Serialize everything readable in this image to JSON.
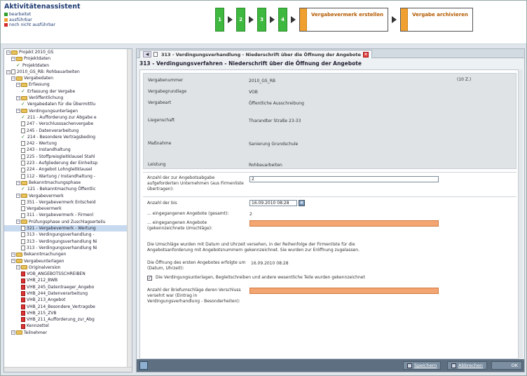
{
  "app": {
    "title": "Aktivitätenassistent",
    "legend": [
      {
        "label": "bearbeitet",
        "color": "#2e9e2e"
      },
      {
        "label": "ausführbar",
        "color": "#f0a030"
      },
      {
        "label": "noch nicht ausführbar",
        "color": "#d22b2b"
      }
    ]
  },
  "wizard": {
    "steps": [
      "1",
      "2",
      "3",
      "4"
    ],
    "boxes": [
      "Vergabevermerk erstellen",
      "Vergabe archivieren"
    ]
  },
  "tree": {
    "items": [
      {
        "label": "Projekt 2010_GS",
        "icon": "folder-icon",
        "indent": 0
      },
      {
        "label": "Projektdaten",
        "icon": "folder-icon",
        "indent": 1
      },
      {
        "label": "Projektdaten",
        "icon": "check-icon",
        "indent": 2
      },
      {
        "label": "2010_GS_RB: Rohbauarbeiten",
        "icon": "doc-icon",
        "indent": 0
      },
      {
        "label": "Vergabedaten",
        "icon": "folder-icon",
        "indent": 1
      },
      {
        "label": "Erfassung",
        "icon": "folder-icon",
        "indent": 2
      },
      {
        "label": "Erfassung der Vergabe",
        "icon": "check-icon",
        "indent": 3
      },
      {
        "label": "Veröffentlichung",
        "icon": "folder-icon",
        "indent": 2
      },
      {
        "label": "Vergabedaten für die Übermittlu",
        "icon": "check-icon",
        "indent": 3
      },
      {
        "label": "Verdingungsunterlagen",
        "icon": "folder-icon",
        "indent": 2
      },
      {
        "label": "211 - Aufforderung zur Abgabe e",
        "icon": "check-icon",
        "indent": 3
      },
      {
        "label": "247 - Verschlusssachenvergabe",
        "icon": "doc-icon",
        "indent": 3
      },
      {
        "label": "245 - Datenverarbeitung",
        "icon": "doc-icon",
        "indent": 3
      },
      {
        "label": "214 - Besondere Vertragsbeding",
        "icon": "check-icon",
        "indent": 3
      },
      {
        "label": "242 - Wertung",
        "icon": "doc-icon",
        "indent": 3
      },
      {
        "label": "243 - Instandhaltung",
        "icon": "doc-icon",
        "indent": 3
      },
      {
        "label": "225 - Stoffpreisgleitklausel Stahl",
        "icon": "doc-icon",
        "indent": 3
      },
      {
        "label": "223 - Aufgliederung der Einheitsp",
        "icon": "doc-icon",
        "indent": 3
      },
      {
        "label": "224 - Angebot Lohngleitklausel",
        "icon": "doc-icon",
        "indent": 3
      },
      {
        "label": "112 - Wartung / Instandhaltung -",
        "icon": "doc-icon",
        "indent": 3
      },
      {
        "label": "Bekanntmachungsphase",
        "icon": "folder-icon",
        "indent": 2
      },
      {
        "label": "121 - Bekanntmachung Öffentlic",
        "icon": "check-icon",
        "indent": 3
      },
      {
        "label": "Vergabevermerk",
        "icon": "folder-icon",
        "indent": 2
      },
      {
        "label": "351 - Vergabevermerk Entscheid",
        "icon": "doc-icon",
        "indent": 3
      },
      {
        "label": "Vergabevermerk",
        "icon": "doc-icon",
        "indent": 3
      },
      {
        "label": "311 - Vergabevermerk - Firmenl",
        "icon": "doc-icon",
        "indent": 3
      },
      {
        "label": "Prüfungsphase und Zuschlagserteilu",
        "icon": "folder-icon",
        "indent": 2
      },
      {
        "label": "321 - Vergabevermerk - Wertung",
        "icon": "doc-icon",
        "indent": 3,
        "selected": true
      },
      {
        "label": "313 - Verdingungsverhandlung -",
        "icon": "doc-icon",
        "indent": 3
      },
      {
        "label": "313 - Verdingungsverhandlung Ni",
        "icon": "doc-icon",
        "indent": 3
      },
      {
        "label": "313 - Verdingungsverhandlung Ni",
        "icon": "doc-icon",
        "indent": 3
      },
      {
        "label": "Bekanntmachungen",
        "icon": "folder-icon",
        "indent": 1
      },
      {
        "label": "Vergabeunterlagen",
        "icon": "folder-icon",
        "indent": 1
      },
      {
        "label": "Originalversion",
        "icon": "folder-icon",
        "indent": 2
      },
      {
        "label": "VOB_ANGEBOTSSCHREIBEN",
        "icon": "pdf-icon",
        "indent": 3
      },
      {
        "label": "VHB_212_BWB",
        "icon": "pdf-icon",
        "indent": 3
      },
      {
        "label": "VHB_245_Datentraeger_Angebo",
        "icon": "pdf-icon",
        "indent": 3
      },
      {
        "label": "VHB_244_Datenverarbeitung",
        "icon": "pdf-icon",
        "indent": 3
      },
      {
        "label": "VHB_213_Angebot",
        "icon": "pdf-icon",
        "indent": 3
      },
      {
        "label": "VHB_214_Besondere_Vertragsbe",
        "icon": "pdf-icon",
        "indent": 3
      },
      {
        "label": "VHB_215_ZVB",
        "icon": "pdf-icon",
        "indent": 3
      },
      {
        "label": "VHB_211_Aufforderung_zur_Abg",
        "icon": "pdf-icon",
        "indent": 3
      },
      {
        "label": "Kennzettel",
        "icon": "pdf-icon",
        "indent": 3
      },
      {
        "label": "Teilnehmer",
        "icon": "folder-icon",
        "indent": 1
      }
    ]
  },
  "main": {
    "tab_label": "313 - Verdingungsverhandlung - Niederschrift über die Öffnung der Angebote",
    "heading": "313 - Verdingungsverfahren - Niederschrift über die Öffnung der Angebote",
    "info": [
      {
        "label": "Vergabenummer",
        "value": "2010_GS_RB"
      },
      {
        "label": "Vergabegrundlage",
        "value": "VOB"
      },
      {
        "label": "Vergabeart",
        "value": "Öffentliche Ausschreibung"
      },
      {
        "label": "Liegenschaft",
        "value": "Tharandter Straße 23-33"
      },
      {
        "label": "Maßnahme",
        "value": "Sanierung Grundschule"
      },
      {
        "label": "Leistung",
        "value": "Rohbauarbeiten"
      }
    ],
    "counter": "(10 Z.)",
    "invited_label": "Anzahl der zur Angebotsabgabe aufgeforderten Unternehmen (aus Firmenliste übertragen):",
    "invited_value": "2",
    "until_label": "Anzahl der bis",
    "until_date": "16.09.2010 08:28",
    "received_total_label": "... eingegangenen Angebote (gesamt):",
    "received_total_value": "2",
    "received_marked_label": "... eingegangenen Angebote (gekennzeichnete Umschläge):",
    "note1": "Die Umschläge wurden mit Datum und Uhrzeit versehen, in der Reihenfolge der Firmenliste für die Angebotsanforderung mit Angebotsnummern gekennzeichnet. Sie wurden zur Eröffnung zugelassen.",
    "opening_label": "Die Öffnung des ersten Angebotes erfolgte um (Datum, Uhrzeit):",
    "opening_value": "16.09.2010 08:28",
    "checkbox_label": "Die Verdingungsunterlagen, Begleitschreiben und andere wesentliche Teile wurden gekennzeichnet",
    "checkbox_checked": true,
    "sealed_label": "Anzahl der Briefumschläge deren Verschluss versehrt war (Eintrag in Verdingungsverhandlung - Besonderheiten):"
  },
  "buttons": {
    "save": "Speichern",
    "cancel": "Abbrechen",
    "ok": "OK"
  }
}
